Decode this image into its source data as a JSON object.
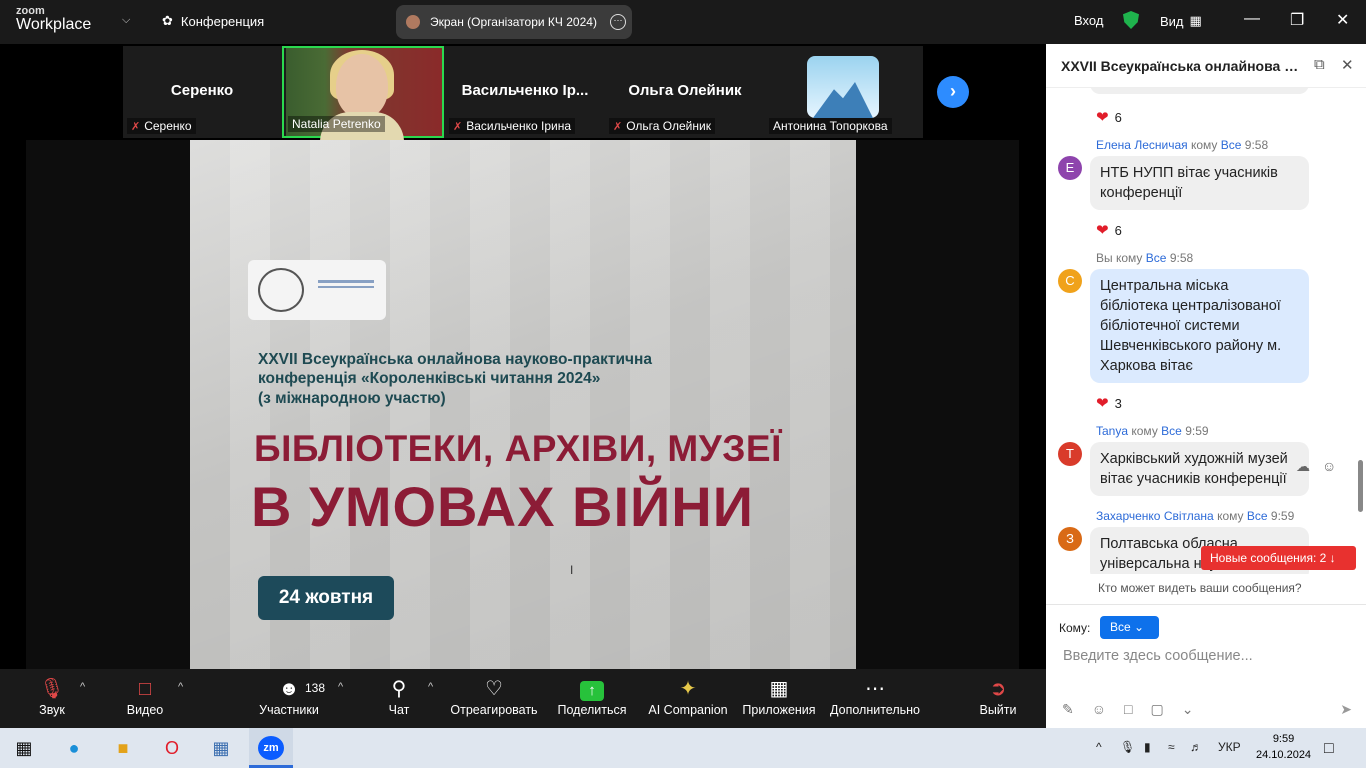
{
  "app": {
    "logo_line1": "zoom",
    "logo_line2": "Workplace",
    "meeting_menu": "Конференция"
  },
  "screen_share": {
    "label": "Экран (Організатори КЧ 2024)"
  },
  "topbar": {
    "signin": "Вход",
    "view": "Вид"
  },
  "participants": [
    {
      "name": "Серенко",
      "caption": "Серенко",
      "muted": true
    },
    {
      "name": "",
      "caption": "Natalia Petrenko",
      "muted": false,
      "video": true
    },
    {
      "name": "Васильченко Ір...",
      "caption": "Васильченко Ірина",
      "muted": true
    },
    {
      "name": "Ольга Олейник",
      "caption": "Ольга Олейник",
      "muted": true
    },
    {
      "name": "",
      "caption": "Антонина Топоркова",
      "muted": false
    }
  ],
  "slide": {
    "subtitle": "XXVII Всеукраїнська онлайнова науково-практична\nконференція «Короленківські читання 2024»\n(з міжнародною участю)",
    "heading1": "БІБЛІОТЕКИ, АРХІВИ, МУЗЕЇ",
    "heading2": "В УМОВАХ ВІЙНИ",
    "date": "24 жовтня"
  },
  "toolbar": {
    "audio": "Звук",
    "video": "Видео",
    "participants": "Участники",
    "participants_count": "138",
    "chat": "Чат",
    "react": "Отреагировать",
    "share": "Поделиться",
    "ai": "AI Companion",
    "apps": "Приложения",
    "more": "Дополнительно",
    "leave": "Выйти"
  },
  "chat": {
    "title": "XXVII Всеукраїнська онлайнова нау...",
    "to_word": "кому",
    "all": "Все",
    "messages": [
      {
        "reaction": "6"
      },
      {
        "sender": "Елена Лесничая",
        "time": "9:58",
        "avatar": "Е",
        "avatar_color": "#8e44ad",
        "text": "НТБ НУПП вітає учасників конференції",
        "reaction": "6"
      },
      {
        "sender": "Вы",
        "time": "9:58",
        "avatar": "С",
        "avatar_color": "#f0a21b",
        "text": "Центральна міська бібліотека централізованої бібліотечної системи Шевченківського району м. Харкова вітає",
        "reaction": "3"
      },
      {
        "sender": "Tanya",
        "time": "9:59",
        "avatar": "T",
        "avatar_color": "#d93b2b",
        "text": "Харківський художній музей вітає учасників конференції"
      },
      {
        "sender": "Захарченко Світлана",
        "time": "9:59",
        "avatar": "З",
        "avatar_color": "#d96a16",
        "text": "Полтавська обласна універсальна наукова"
      }
    ],
    "new_messages": "Новые сообщения: 2",
    "who_can_see": "Кто может видеть ваши сообщения?",
    "to_label": "Кому:",
    "to_value": "Все",
    "input_placeholder": "Введите здесь сообщение..."
  },
  "taskbar": {
    "lang": "УКР",
    "time": "9:59",
    "date": "24.10.2024"
  }
}
